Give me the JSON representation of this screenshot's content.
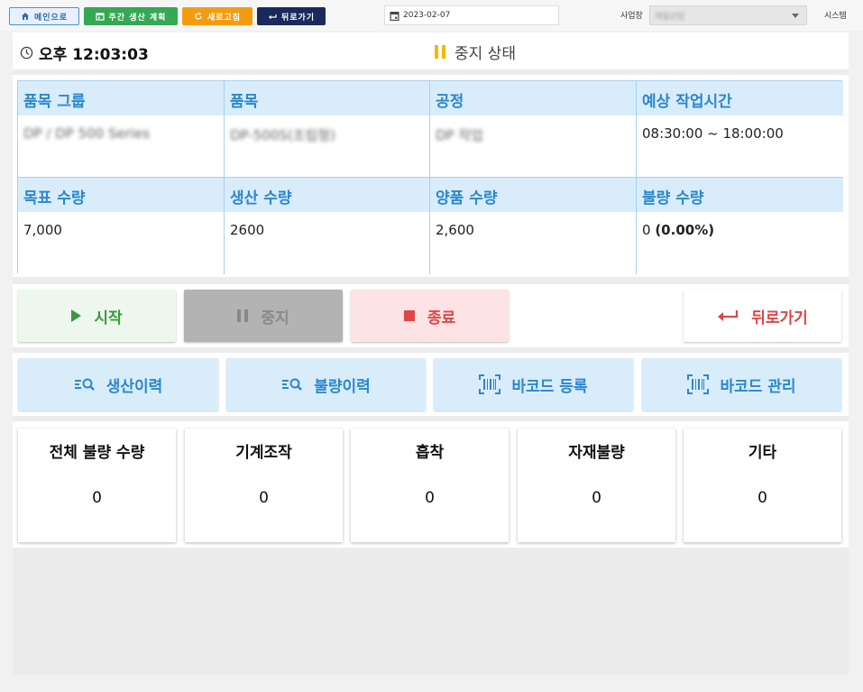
{
  "toolbar": {
    "main_label": "메인으로",
    "weekly_label": "주간 생산 계획",
    "refresh_label": "새로고침",
    "back_label": "뒤로가기",
    "date_value": "2023-02-07",
    "site_label": "사업장",
    "site_value": "제일산업",
    "system_label": "시스템"
  },
  "status": {
    "time": "오후 12:03:03",
    "state": "중지 상태"
  },
  "info": {
    "item_group_label": "품목 그룹",
    "item_group_value": "DP / DP 500 Series",
    "item_label": "품목",
    "item_value": "DP-500S(조립형)",
    "process_label": "공정",
    "process_value": "DP 작업",
    "work_time_label": "예상 작업시간",
    "work_time_value": "08:30:00 ~ 18:00:00",
    "target_qty_label": "목표 수량",
    "target_qty_value": "7,000",
    "produced_qty_label": "생산 수량",
    "produced_qty_value": "2600",
    "good_qty_label": "양품 수량",
    "good_qty_value": "2,600",
    "defect_qty_label": "불량 수량",
    "defect_qty_value": "0",
    "defect_qty_percent": "(0.00%)"
  },
  "actions": {
    "start": "시작",
    "stop": "중지",
    "end": "종료",
    "back": "뒤로가기"
  },
  "history": {
    "production_history": "생산이력",
    "defect_history": "불량이력",
    "barcode_register": "바코드 등록",
    "barcode_manage": "바코드 관리"
  },
  "defects": [
    {
      "title": "전체 불량 수량",
      "count": "0"
    },
    {
      "title": "기계조작",
      "count": "0"
    },
    {
      "title": "흡착",
      "count": "0"
    },
    {
      "title": "자재불량",
      "count": "0"
    },
    {
      "title": "기타",
      "count": "0"
    }
  ]
}
